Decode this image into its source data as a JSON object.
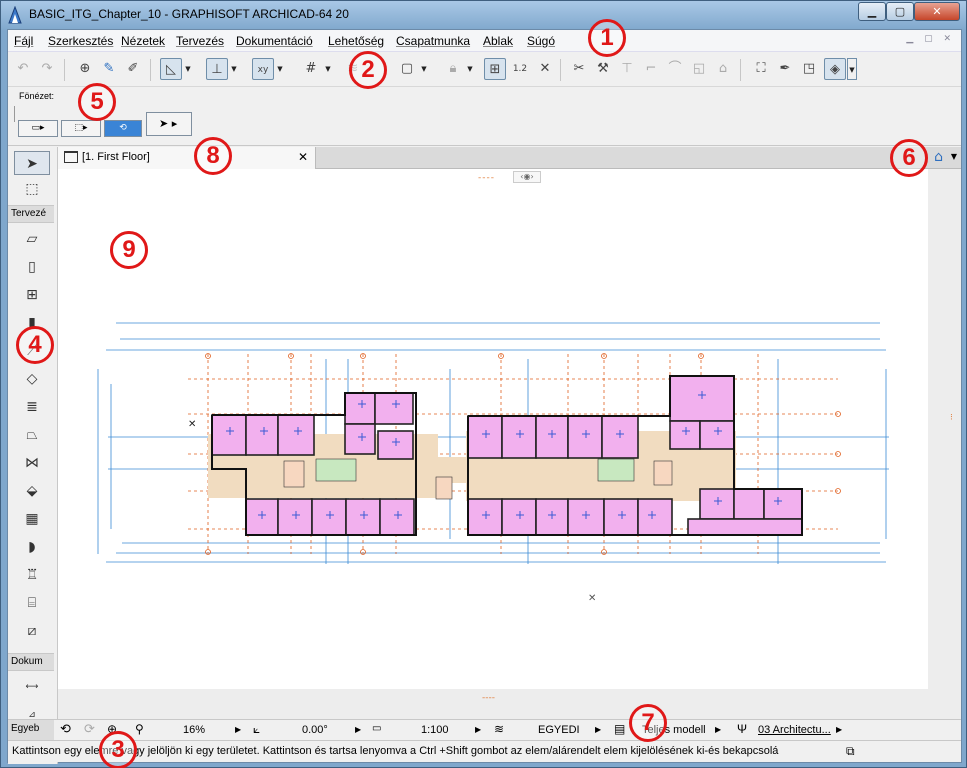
{
  "window": {
    "title": "BASIC_ITG_Chapter_10 - GRAPHISOFT ARCHICAD-64 20",
    "min": "▁",
    "max": "▢",
    "close": "✕"
  },
  "menu": [
    {
      "label": "Fájl"
    },
    {
      "label": "Szerkesztés"
    },
    {
      "label": "Nézetek"
    },
    {
      "label": "Tervezés"
    },
    {
      "label": "Dokumentáció"
    },
    {
      "label": "Lehetőség"
    },
    {
      "label": "Csapatmunka"
    },
    {
      "label": "Ablak"
    },
    {
      "label": "Súgó"
    }
  ],
  "infobox": {
    "label": "Fönézet:"
  },
  "toolbox": {
    "sections": [
      {
        "label": "Tervezé"
      },
      {
        "label": "Dokum"
      }
    ]
  },
  "tab": {
    "label": "[1. First Floor]",
    "close": "✕"
  },
  "statusbar": {
    "section": "Egyeb",
    "zoom": "16%",
    "angle": "0.00°",
    "scale": "1:100",
    "layer_combo": "EGYEDI",
    "model_view": "Teljes modell",
    "pen_set": "03 Architectu..."
  },
  "status_message": "Kattintson egy elemre vagy jelöljön ki egy területet. Kattintson és tartsa lenyomva a Ctrl +Shift gombot az elem/alárendelt elem kijelölésének ki-és bekapcsolá",
  "callouts": [
    "1",
    "2",
    "3",
    "4",
    "5",
    "6",
    "7",
    "8",
    "9"
  ],
  "colors": {
    "room_fill": "#f2b0ee",
    "grid_line": "#e06020",
    "dimension": "#3a8ad4",
    "callout": "#e01818",
    "selection": "#3a84d6"
  }
}
